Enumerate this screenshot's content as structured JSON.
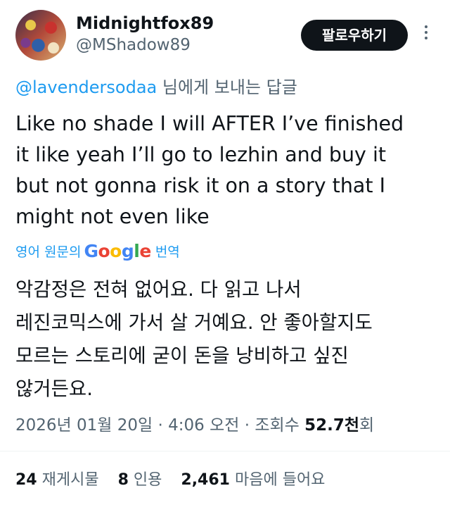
{
  "author": {
    "display_name": "Midnightfox89",
    "handle": "@MShadow89"
  },
  "follow_button_label": "팔로우하기",
  "reply_to": {
    "mention": "@lavendersodaa",
    "suffix": " 님에게 보내는 답글"
  },
  "tweet_lines": [
    "Like no shade I will AFTER I’ve finished",
    "it like yeah I’ll go to lezhin and buy it",
    "but not gonna risk it on a story that I",
    "might not even like"
  ],
  "translation": {
    "prefix": "영어 원문의",
    "logo_text": "Google",
    "suffix": "번역",
    "lines": [
      "악감정은 전혀 없어요. 다 읽고 나서",
      "레진코믹스에 가서 살 거예요. 안 좋아할지도",
      "모르는 스토리에 굳이 돈을 낭비하고 싶진",
      "않거든요."
    ]
  },
  "meta": {
    "date": "2026년 01월 20일",
    "time": "4:06 오전",
    "views_label": "조회수",
    "views_value": "52.7천",
    "views_unit": "회"
  },
  "stats": {
    "reposts_count": "24",
    "reposts_label": "재게시물",
    "quotes_count": "8",
    "quotes_label": "인용",
    "likes_count": "2,461",
    "likes_label": "마음에 들어요"
  },
  "colors": {
    "accent": "#1d9bf0",
    "text": "#0f1419",
    "muted": "#536471",
    "button_bg": "#0f1419"
  }
}
